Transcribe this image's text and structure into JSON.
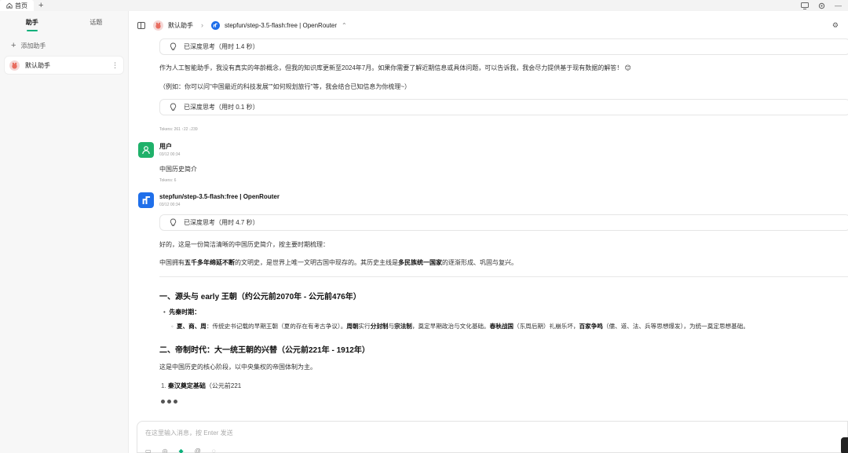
{
  "top_tab": {
    "label": "首页",
    "icon": "home-icon"
  },
  "sidebar": {
    "tabs": [
      "助手",
      "话题"
    ],
    "add_label": "添加助手",
    "assistants": [
      {
        "label": "默认助手",
        "icon": "assistant-avatar"
      }
    ]
  },
  "header": {
    "assistant": "默认助手",
    "model": "stepfun/step-3.5-flash:free | OpenRouter"
  },
  "messages": {
    "think1": "已深度思考（用时 1.4 秒）",
    "reply1": "作为人工智能助手，我没有真实的年龄概念，但我的知识库更新至2024年7月。如果你需要了解近期信息或具体问题，可以告诉我，我会尽力提供基于现有数据的解答！",
    "reply1_emoji": "😊",
    "reply2": "（例如：你可以问\"中国最近的科技发展\"\"如何规划旅行\"等，我会结合已知信息为你梳理~）",
    "think2": "已深度思考（用时 0.1 秒）",
    "tokens1": "Tokens: 261 ↑22 ↓239",
    "user_name": "用户",
    "user_time": "03/12 00:34",
    "user_text": "中国历史简介",
    "tokens2": "Tokens: 6",
    "bot_name": "stepfun/step-3.5-flash:free | OpenRouter",
    "bot_time": "03/12 00:34",
    "think3": "已深度思考（用时 4.7 秒）",
    "intro": "好的，这是一份简洁清晰的中国历史简介，按主要时期梳理：",
    "summary_a": "中国拥有",
    "summary_b": "五千多年绵延不断",
    "summary_c": "的文明史，是世界上唯一文明古国中现存的。其历史主线是",
    "summary_d": "多民族统一国家",
    "summary_e": "的逐渐形成、巩固与复兴。",
    "section1": "一、源头与 early 王朝（约公元前2070年 - 公元前476年）",
    "s1_bullet": "先秦时期：",
    "s1_sub_a": "夏、商、周",
    "s1_sub_b": "：传统史书记载的早期王朝（夏的存在有考古争议）。",
    "s1_sub_c": "周朝",
    "s1_sub_d": "实行",
    "s1_sub_e": "分封制",
    "s1_sub_f": "与",
    "s1_sub_g": "宗法制",
    "s1_sub_h": "，奠定早期政治与文化基础。",
    "s1_sub_i": "春秋战国",
    "s1_sub_j": "（东周后期）礼崩乐坏，",
    "s1_sub_k": "百家争鸣",
    "s1_sub_l": "（儒、道、法、兵等思想爆发），为统一奠定思想基础。",
    "section2": "二、帝制时代：大一统王朝的兴替（公元前221年 - 1912年）",
    "s2_intro": "这是中国历史的核心阶段，以中央集权的帝国体制为主。",
    "s2_item_a": "秦汉奠定基础",
    "s2_item_b": "（公元前221"
  },
  "input": {
    "placeholder": "在这里输入消息，按 Enter 发送"
  },
  "colors": {
    "accent": "#0bb07b",
    "user_avatar": "#1fb16a",
    "model_blue": "#1f6fea"
  }
}
